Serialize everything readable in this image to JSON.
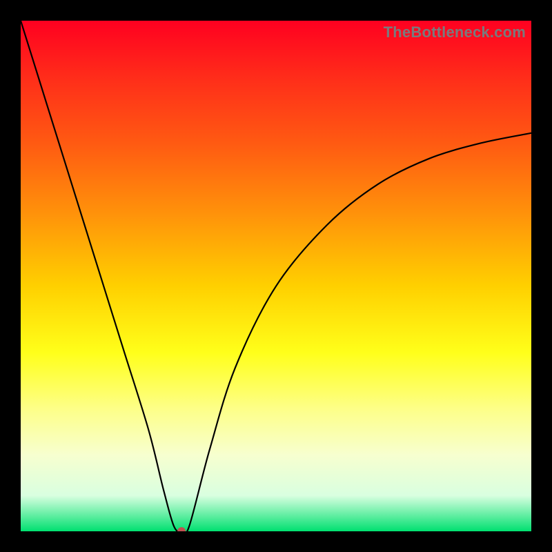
{
  "watermark": "TheBottleneck.com",
  "chart_data": {
    "type": "line",
    "title": "",
    "xlabel": "",
    "ylabel": "",
    "xlim": [
      0,
      100
    ],
    "ylim": [
      0,
      100
    ],
    "grid": false,
    "legend": false,
    "series": [
      {
        "name": "bottleneck-curve",
        "x": [
          0,
          5,
          10,
          15,
          20,
          25,
          28,
          30,
          31.5,
          33,
          37,
          42,
          50,
          60,
          70,
          80,
          90,
          100
        ],
        "values": [
          100,
          84,
          68,
          52,
          36,
          20,
          8,
          1,
          0,
          1,
          16,
          32,
          48,
          60,
          68,
          73,
          76,
          78
        ]
      }
    ],
    "marker": {
      "x": 31.5,
      "y": 0,
      "color": "#c05050"
    },
    "gradient_colors": {
      "top": "#ff0020",
      "upper_mid": "#ff930a",
      "mid": "#ffff1a",
      "lower_mid": "#f7ffcf",
      "bottom": "#00e070"
    }
  }
}
